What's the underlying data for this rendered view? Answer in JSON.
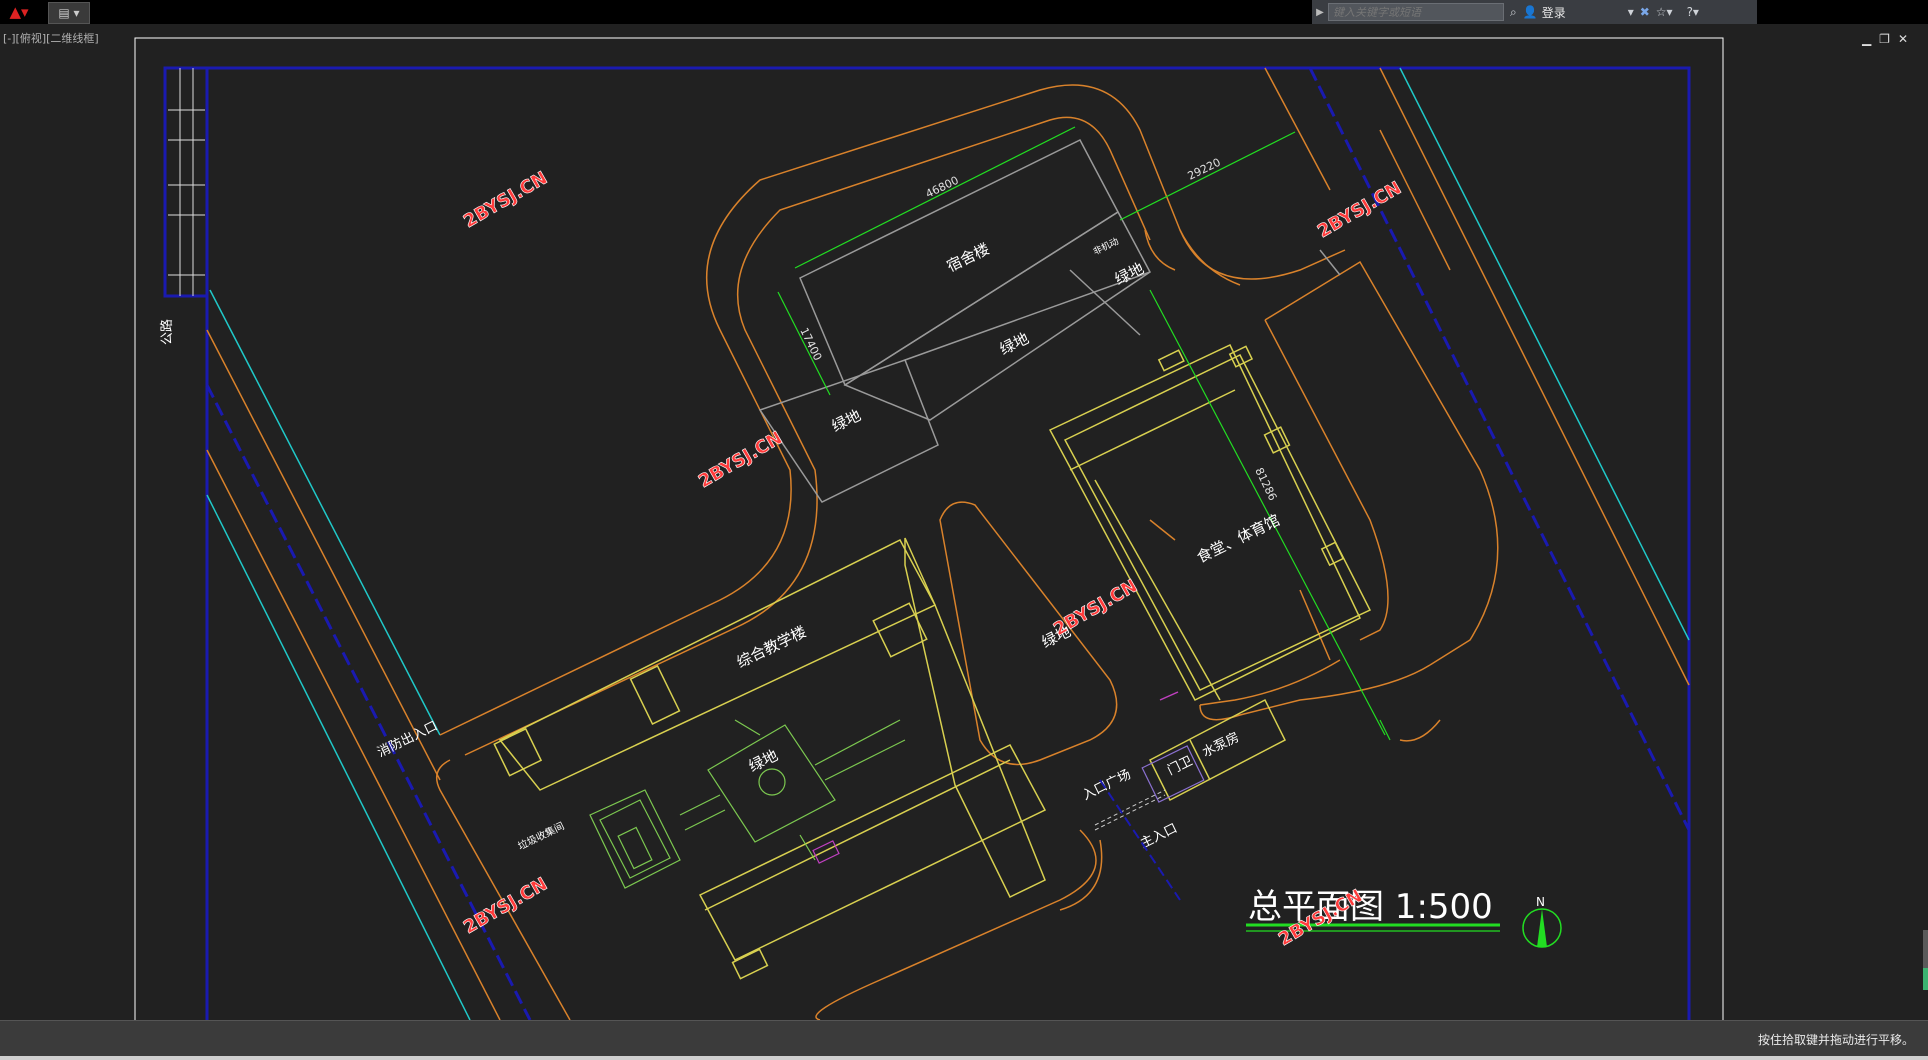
{
  "app": {
    "search_placeholder": "键入关键字或短语",
    "login_label": "登录",
    "viewport_label": "[-][俯视][二维线框]",
    "status_message": "按住拾取键并拖动进行平移。"
  },
  "icons": {
    "app_menu": "autocad-logo-icon",
    "quick_access": "quick-access-icon",
    "binoculars": "binoculars-icon",
    "user": "user-icon",
    "exchange": "exchange-icon",
    "star": "star-icon",
    "help": "help-icon"
  },
  "drawing": {
    "title": "总平面图 1:500",
    "north_label": "N",
    "labels": {
      "dorm": "宿舍楼",
      "green1": "绿地",
      "green2": "绿地",
      "green3": "绿地",
      "green4": "绿地",
      "green5": "绿地",
      "teaching": "综合教学楼",
      "canteen": "食堂、体育馆",
      "fire_entrance": "消防出入口",
      "plaza": "入口广场",
      "main_entrance": "主入口",
      "guard": "门卫",
      "pump": "水泵房",
      "garbage": "垃圾收集间",
      "parking": "非机动",
      "road": "公路"
    },
    "dimensions": {
      "dorm_length": "46800",
      "dorm_width": "17400",
      "offset": "29220",
      "canteen_length": "81286"
    },
    "watermark": "2BYSJ.CN"
  },
  "colors": {
    "background": "#212121",
    "frame_blue": "#1a1ab0",
    "cyan": "#20c8c8",
    "orange": "#d9822b",
    "yellow": "#d8d050",
    "green": "#22dd22",
    "gray": "#9a9a9a",
    "watermark": "#ff3b3b"
  }
}
